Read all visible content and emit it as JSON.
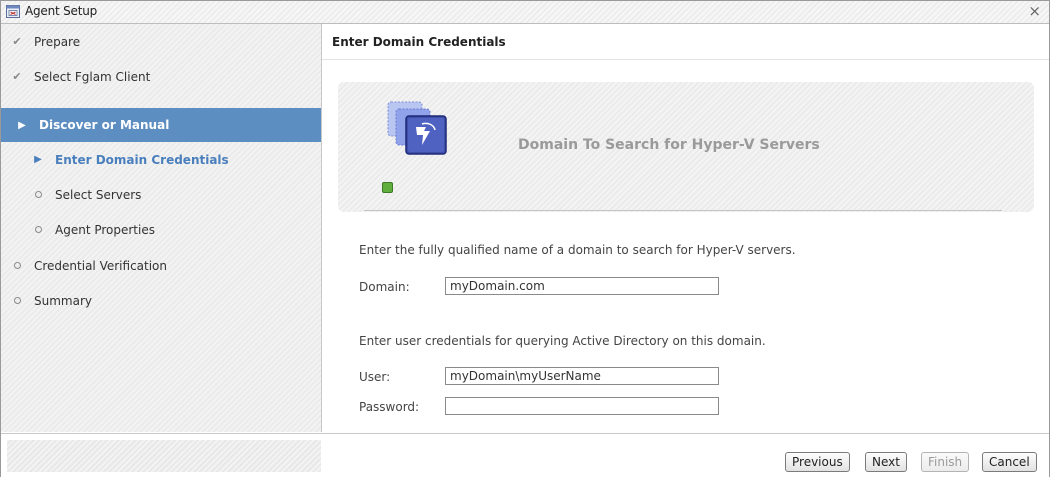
{
  "window": {
    "title": "Agent Setup",
    "close_glyph": "×",
    "icon": "agent-setup-icon"
  },
  "sidebar": {
    "steps": [
      {
        "label": "Prepare",
        "state": "done"
      },
      {
        "label": "Select Fglam Client",
        "state": "done"
      },
      {
        "label": "Discover or Manual",
        "state": "active"
      },
      {
        "label": "Enter Domain Credentials",
        "state": "current-sub"
      },
      {
        "label": "Select Servers",
        "state": "pending-sub"
      },
      {
        "label": "Agent Properties",
        "state": "pending-sub"
      },
      {
        "label": "Credential Verification",
        "state": "pending"
      },
      {
        "label": "Summary",
        "state": "pending"
      }
    ]
  },
  "main": {
    "header": "Enter Domain Credentials",
    "banner_title": "Domain To Search for Hyper-V Servers",
    "domain_instructions": "Enter the fully qualified name of a domain to search for Hyper-V servers.",
    "domain_label": "Domain:",
    "domain_value": "myDomain.com",
    "user_instructions": "Enter user credentials for querying Active Directory on this domain.",
    "user_label": "User:",
    "user_value": "myDomain\\myUserName",
    "password_label": "Password:",
    "password_value": ""
  },
  "footer": {
    "previous_label": "Previous",
    "next_label": "Next",
    "finish_label": "Finish",
    "cancel_label": "Cancel"
  },
  "colors": {
    "active_step": "#5d8ec1",
    "current_sub_step": "#4a7fbd",
    "status_led": "#5fae3e"
  }
}
